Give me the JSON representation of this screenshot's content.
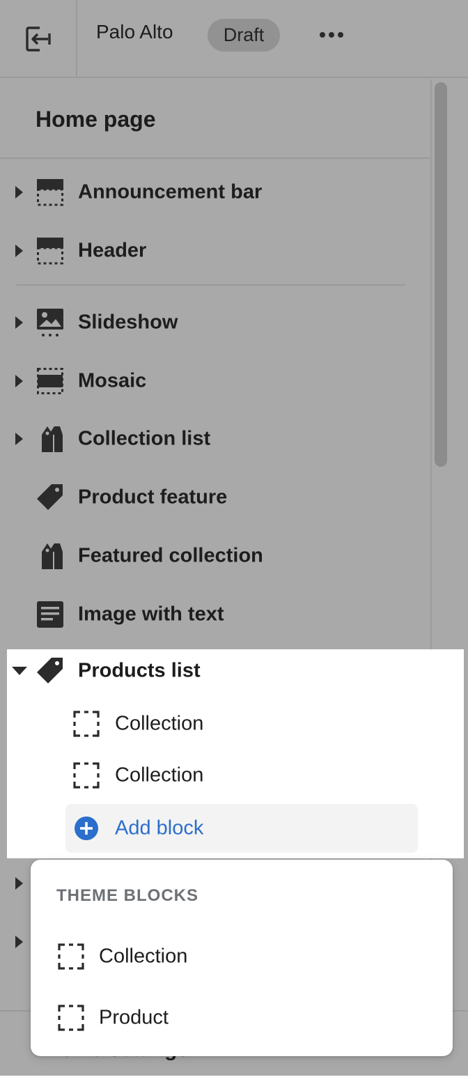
{
  "topbar": {
    "store_name": "Palo Alto",
    "status_badge": "Draft"
  },
  "panel": {
    "title": "Home page"
  },
  "sections": [
    {
      "label": "Announcement bar",
      "icon": "layout-header-icon",
      "expandable": true
    },
    {
      "label": "Header",
      "icon": "layout-header-icon",
      "expandable": true
    },
    {
      "label": "Slideshow",
      "icon": "image-slideshow-icon",
      "expandable": true
    },
    {
      "label": "Mosaic",
      "icon": "layout-mosaic-icon",
      "expandable": true
    },
    {
      "label": "Collection list",
      "icon": "collection-tags-icon",
      "expandable": true
    },
    {
      "label": "Product feature",
      "icon": "tag-icon",
      "expandable": false
    },
    {
      "label": "Featured collection",
      "icon": "collection-tags-icon",
      "expandable": false
    },
    {
      "label": "Image with text",
      "icon": "text-block-icon",
      "expandable": false
    }
  ],
  "products_list": {
    "label": "Products list",
    "blocks": [
      {
        "label": "Collection"
      },
      {
        "label": "Collection"
      }
    ],
    "add_block_label": "Add block"
  },
  "popover": {
    "heading": "THEME BLOCKS",
    "items": [
      {
        "label": "Collection"
      },
      {
        "label": "Product"
      }
    ]
  },
  "footer": {
    "theme_settings_label": "Theme settings"
  },
  "colors": {
    "overlay": "#a9a9a9",
    "accent": "#2c6ecb",
    "icon": "#2b2b2b"
  }
}
